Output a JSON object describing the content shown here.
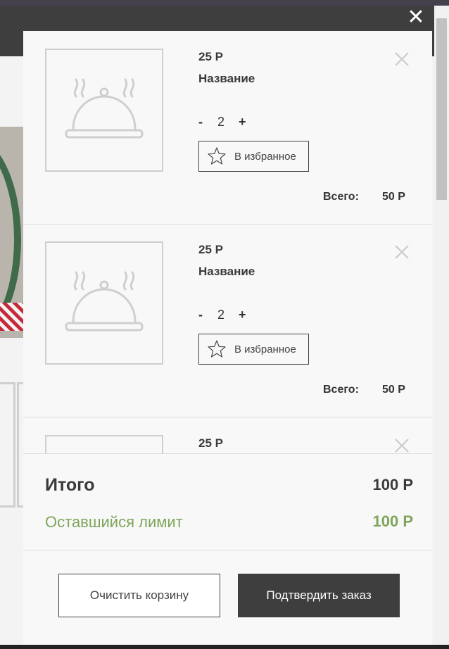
{
  "cart": {
    "items": [
      {
        "price": "25 Р",
        "name": "Название",
        "qty": {
          "minus": "-",
          "value": "2",
          "plus": "+"
        },
        "favorite_label": "В избранное",
        "total_label": "Всего:",
        "total_value": "50 Р"
      },
      {
        "price": "25 Р",
        "name": "Название",
        "qty": {
          "minus": "-",
          "value": "2",
          "plus": "+"
        },
        "favorite_label": "В избранное",
        "total_label": "Всего:",
        "total_value": "50 Р"
      },
      {
        "price": "25 Р"
      }
    ],
    "summary": {
      "total_label": "Итого",
      "total_value": "100 Р",
      "limit_label": "Оставшийся лимит",
      "limit_value": "100 Р"
    },
    "buttons": {
      "clear": "Очистить корзину",
      "confirm": "Подтвердить заказ"
    },
    "close_glyph": "✕"
  },
  "colors": {
    "dark": "#3e3e3e",
    "accent_green": "#7ea55a",
    "border_light": "#cfcfcf"
  },
  "icons": [
    "close-icon",
    "dish-cloche-icon",
    "star-icon",
    "remove-x-icon"
  ]
}
